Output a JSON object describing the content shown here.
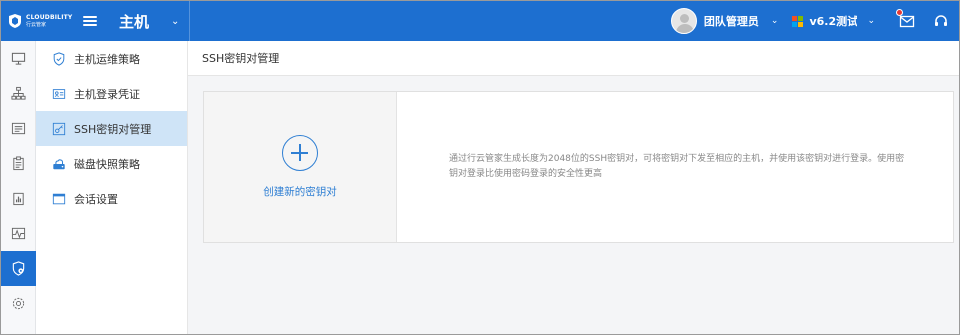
{
  "topbar": {
    "logo_en": "CLOUDBILITY",
    "logo_cn": "行云管家",
    "module": "主机",
    "user_name": "团队管理员",
    "version": "v6.2测试",
    "colors": {
      "bar": "#1d6fd0",
      "notify_dot": "#e53935"
    },
    "win_colors": [
      "#f25022",
      "#7fba00",
      "#00a4ef",
      "#ffb900"
    ]
  },
  "rail": {
    "items": [
      {
        "icon": "monitor-icon"
      },
      {
        "icon": "org-tree-icon"
      },
      {
        "icon": "list-box-icon"
      },
      {
        "icon": "clipboard-icon"
      },
      {
        "icon": "report-icon"
      },
      {
        "icon": "activity-icon"
      },
      {
        "icon": "shield-gear-icon",
        "active": true
      },
      {
        "icon": "gear-icon"
      }
    ]
  },
  "submenu": {
    "items": [
      {
        "label": "主机运维策略",
        "icon": "shield-check-icon"
      },
      {
        "label": "主机登录凭证",
        "icon": "id-card-icon"
      },
      {
        "label": "SSH密钥对管理",
        "icon": "key-icon",
        "active": true
      },
      {
        "label": "磁盘快照策略",
        "icon": "disk-cloud-icon"
      },
      {
        "label": "会话设置",
        "icon": "window-icon"
      }
    ]
  },
  "main": {
    "title": "SSH密钥对管理",
    "create_label": "创建新的密钥对",
    "description": "通过行云管家生成长度为2048位的SSH密钥对，可将密钥对下发至相应的主机，并使用该密钥对进行登录。使用密钥对登录比使用密码登录的安全性更高"
  }
}
